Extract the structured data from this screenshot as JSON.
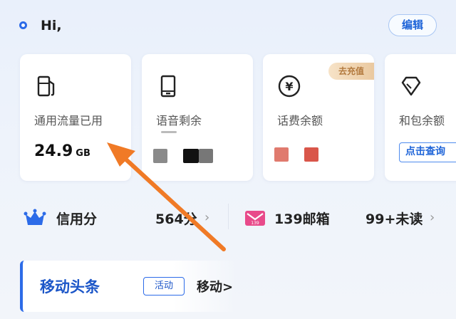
{
  "header": {
    "greeting": "Hi,",
    "edit_label": "编辑"
  },
  "cards": [
    {
      "label": "通用流量已用",
      "value": "24.9",
      "unit": "GB",
      "icon": "fuel-pump-icon"
    },
    {
      "label": "语音剩余",
      "icon": "phone-icon"
    },
    {
      "label": "话费余额",
      "badge": "去充值",
      "icon": "yen-icon"
    },
    {
      "label": "和包余额",
      "button": "点击查询",
      "icon": "diamond-icon"
    }
  ],
  "credit": {
    "label": "信用分",
    "value": "564分",
    "icon": "crown-icon"
  },
  "mail": {
    "label": "139邮箱",
    "unread": "99+未读",
    "icon": "mail-icon"
  },
  "news": {
    "title": "移动头条",
    "tag": "活动",
    "text": "移动>"
  },
  "colors": {
    "accent": "#2c6be8",
    "arrow": "#f07a26",
    "badge_text": "#b37a3e"
  }
}
